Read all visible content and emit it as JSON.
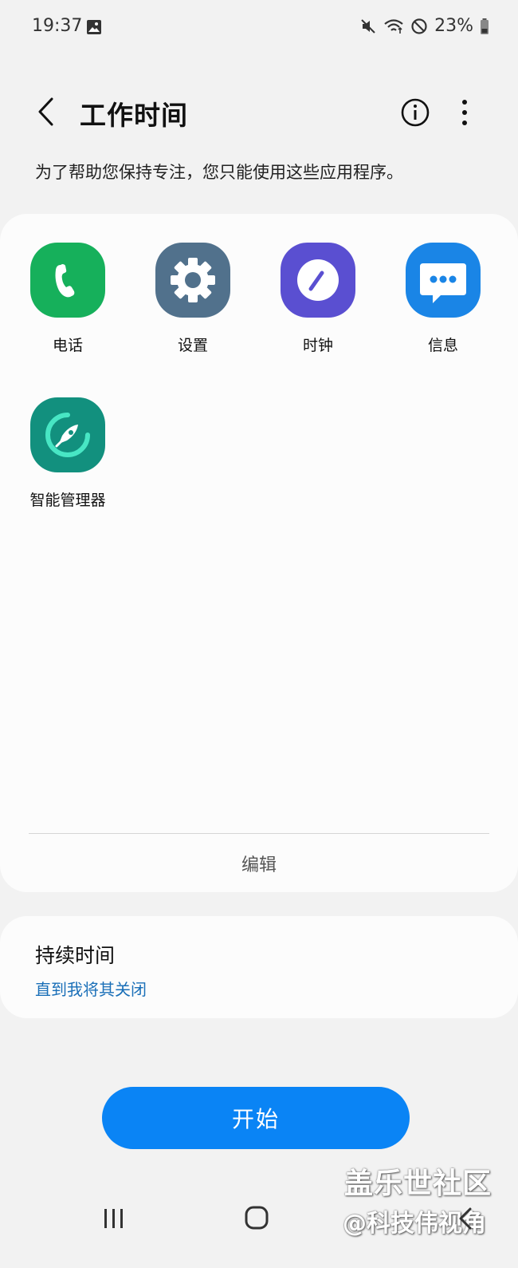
{
  "status_bar": {
    "time": "19:37",
    "battery_percent": "23%",
    "icons": [
      "gallery-icon",
      "mute-icon",
      "wifi-icon",
      "do-not-disturb-icon",
      "battery-icon"
    ]
  },
  "header": {
    "title": "工作时间",
    "icons": [
      "back-arrow-icon",
      "info-icon",
      "more-vert-icon"
    ]
  },
  "subtitle": "为了帮助您保持专注，您只能使用这些应用程序。",
  "apps": [
    {
      "label": "电话",
      "icon": "phone-icon",
      "color": "#16b05b"
    },
    {
      "label": "设置",
      "icon": "gear-icon",
      "color": "#51718c"
    },
    {
      "label": "时钟",
      "icon": "clock-icon",
      "color": "#5a4fd1"
    },
    {
      "label": "信息",
      "icon": "message-icon",
      "color": "#1a85e6"
    },
    {
      "label": "智能管理器",
      "icon": "rocket-icon",
      "color": "#12907e"
    }
  ],
  "edit_label": "编辑",
  "duration": {
    "title": "持续时间",
    "value": "直到我将其关闭"
  },
  "start_label": "开始",
  "nav_bar": {
    "icons": [
      "recents-icon",
      "home-icon",
      "nav-back-icon"
    ]
  },
  "watermark": {
    "line1": "盖乐世社区",
    "line2": "@科技伟视角"
  },
  "colors": {
    "accent": "#0a84f5",
    "link": "#1a6fb8",
    "background": "#f2f2f2",
    "card": "#fcfcfc"
  }
}
